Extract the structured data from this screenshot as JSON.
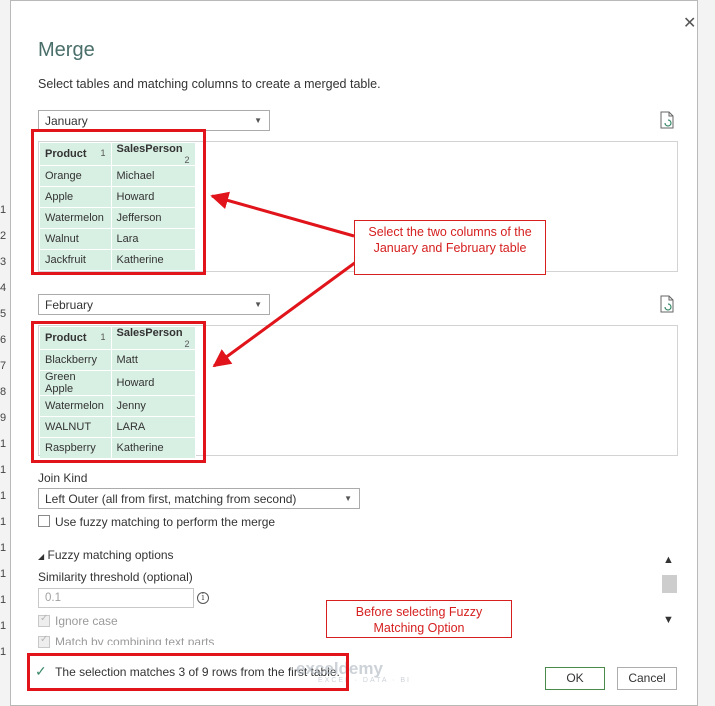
{
  "dialog": {
    "title": "Merge",
    "subtitle": "Select tables and matching columns to create a merged table.",
    "close_glyph": "✕"
  },
  "background_rows": [
    "1",
    "2",
    "3",
    "4",
    "5",
    "6",
    "7",
    "8",
    "9",
    "1",
    "1",
    "1",
    "1",
    "1",
    "1",
    "1",
    "1",
    "1"
  ],
  "table1": {
    "selected": "January",
    "headers": [
      {
        "name": "Product",
        "num": "1"
      },
      {
        "name": "SalesPerson",
        "num": "2"
      }
    ],
    "rows": [
      [
        "Orange",
        "Michael"
      ],
      [
        "Apple",
        "Howard"
      ],
      [
        "Watermelon",
        "Jefferson"
      ],
      [
        "Walnut",
        "Lara"
      ],
      [
        "Jackfruit",
        "Katherine"
      ]
    ]
  },
  "table2": {
    "selected": "February",
    "headers": [
      {
        "name": "Product",
        "num": "1"
      },
      {
        "name": "SalesPerson",
        "num": "2"
      }
    ],
    "rows": [
      [
        "Blackberry",
        "Matt"
      ],
      [
        "Green Apple",
        "Howard"
      ],
      [
        "Watermelon",
        "Jenny"
      ],
      [
        "WALNUT",
        "LARA"
      ],
      [
        "Raspberry",
        "Katherine"
      ]
    ]
  },
  "annotations": {
    "callout1": "Select the two columns of the January and February table",
    "callout2": "Before selecting Fuzzy Matching Option",
    "color": "#e0141a"
  },
  "join": {
    "label": "Join Kind",
    "selected": "Left Outer (all from first, matching from second)",
    "fuzzy_checkbox_label": "Use fuzzy matching to perform the merge",
    "fuzzy_checked": false
  },
  "fuzzy_options": {
    "header": "Fuzzy matching options",
    "similarity_label": "Similarity threshold (optional)",
    "similarity_placeholder": "0.1",
    "ignore_case_label": "Ignore case",
    "combine_label": "Match by combining text parts"
  },
  "status": {
    "text": "The selection matches 3 of 9 rows from the first table."
  },
  "buttons": {
    "ok": "OK",
    "cancel": "Cancel"
  },
  "watermark": {
    "brand": "exceldemy",
    "tagline": "EXCEL · DATA · BI"
  },
  "colors": {
    "title": "#4a6f6a",
    "table_bg": "#d8efe3",
    "accent_check": "#3a8a6a"
  }
}
